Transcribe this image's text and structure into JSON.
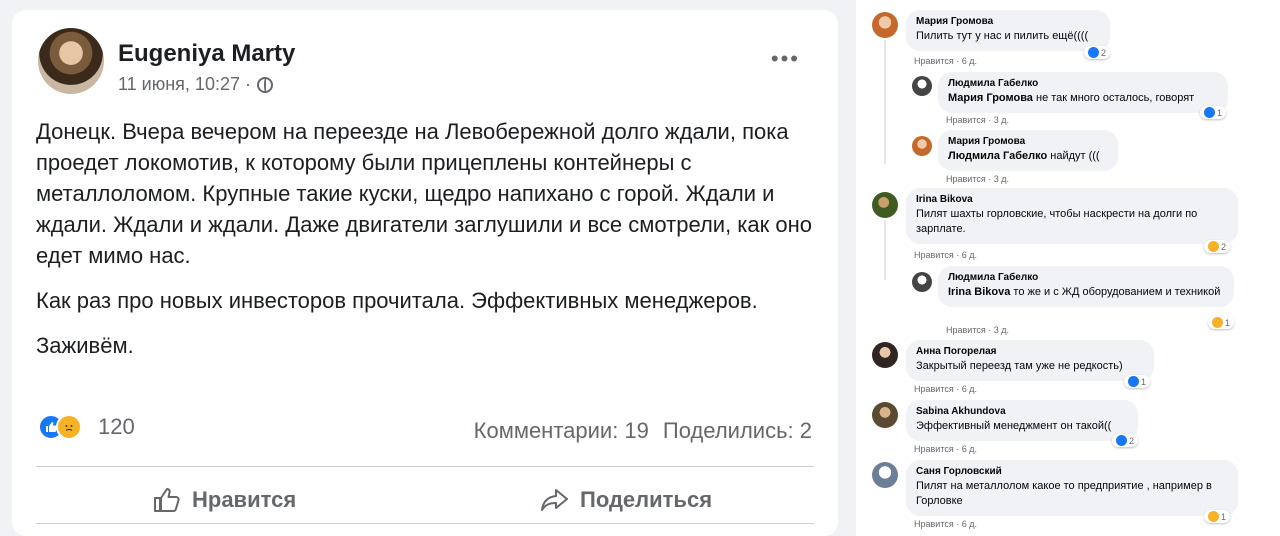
{
  "post": {
    "author": "Eugeniya Marty",
    "meta": "11 июня, 10:27 ·",
    "more": "•••",
    "paragraphs": [
      "Донецк. Вчера вечером на переезде на Левобережной долго ждали, пока проедет локомотив, к которому были прицеплены контейнеры с металлоломом. Крупные такие куски, щедро напихано с горой. Ждали и ждали. Ждали и ждали. Даже двигатели заглушили и все смотрели, как оно едет мимо нас.",
      "Как раз про новых инвесторов прочитала. Эффективных менеджеров.",
      "Заживём."
    ],
    "reaction_count": "120",
    "comments_stat": "Комментарии: 19",
    "shares_stat": "Поделились: 2",
    "like_label": "Нравится",
    "share_label": "Поделиться"
  },
  "comments": [
    {
      "author": "Мария Громова",
      "text": "Пилить тут у нас и пилить ещё((((",
      "meta": "Нравится · 6 д.",
      "react": "2",
      "react_type": "like"
    },
    {
      "author": "Людмила Габелко",
      "mention": "Мария Громова",
      "text": " не так много осталось, говорят",
      "meta": "Нравится · 3 д.",
      "react": "1",
      "react_type": "like"
    },
    {
      "author": "Мария Громова",
      "mention": "Людмила Габелко",
      "text": " найдут (((",
      "meta": "Нравится · 3 д.",
      "react": "",
      "react_type": ""
    },
    {
      "author": "Irina Bikova",
      "text": "Пилят шахты горловские, чтобы наскрести на долги по зарплате.",
      "meta": "Нравится · 6 д.",
      "react": "2",
      "react_type": "sad"
    },
    {
      "author": "Людмила Габелко",
      "mention": "Irina Bikova",
      "text": " то же и с ЖД оборудованием и техникой",
      "meta": "Нравится · 3 д.",
      "react": "1",
      "react_type": "sad"
    },
    {
      "author": "Анна Погорелая",
      "text": "Закрытый переезд там уже не редкость)",
      "meta": "Нравится · 6 д.",
      "react": "1",
      "react_type": "like"
    },
    {
      "author": "Sabina Akhundova",
      "text": "Эффективный менеджмент он такой((",
      "meta": "Нравится · 6 д.",
      "react": "2",
      "react_type": "like"
    },
    {
      "author": "Саня Горловский",
      "text": "Пилят на металлолом какое то предприятие , например в Горловке",
      "meta": "Нравится · 6 д.",
      "react": "1",
      "react_type": "sad"
    }
  ],
  "colors": {
    "accent": "#1877f2",
    "sad": "#f7b125",
    "bubble": "#f0f2f5"
  }
}
